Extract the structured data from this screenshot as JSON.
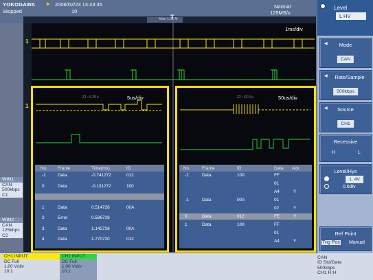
{
  "header": {
    "brand": "YOKOGAWA",
    "datetime": "2006/02/23 13:43:45",
    "run_state": "Stopped",
    "acq_count": "10",
    "acq_mode": "Normal",
    "sample_rate": "125MS/s",
    "trigger_marker": "T"
  },
  "display": {
    "main_time_div": "1ms/div",
    "zoom1_time_div": "5us/div",
    "zoom2_time_div": "50us/div",
    "channel_marker": "1",
    "scroll_label": "Main 1.25 M",
    "zoom1_label": "Z1 : 6.25 k",
    "zoom2_label": "Z2 : 62.5 k"
  },
  "softkeys": {
    "level_title": "Level",
    "level_value": "L  HV",
    "mode_title": "Mode",
    "mode_value": "CAN",
    "rate_title": "Rate/Sample",
    "rate_value": "500kbps",
    "source_title": "Source",
    "source_value": "CH1",
    "recessive_title": "Recessive",
    "recessive_h": "H",
    "recessive_l": "L",
    "level_hys_title": "Level/Hys",
    "level_hys_value": "1.  4V",
    "hys_value": "0.6div",
    "refpoint_title": "Ref Point",
    "refpoint_opt1": "Trig Pos",
    "refpoint_opt2": "Manual"
  },
  "table1": {
    "headers": [
      "No.",
      "Frame",
      "Time(ms)",
      "ID"
    ],
    "rows": [
      {
        "no": "-1",
        "frame": "Data",
        "time": "-0.741272",
        "id": "012",
        "hl": false
      },
      {
        "no": "0",
        "frame": "Data",
        "time": "-0.131272",
        "id": "100",
        "hl": false
      },
      {
        "no": "",
        "frame": "",
        "time": "",
        "id": "",
        "hl": true
      },
      {
        "no": "1",
        "frame": "Data",
        "time": "0.514728",
        "id": "00A",
        "hl": false
      },
      {
        "no": "2",
        "frame": "Error",
        "time": "0.586728",
        "id": "",
        "hl": false
      },
      {
        "no": "3",
        "frame": "Data",
        "time": "1.142728",
        "id": "00A",
        "hl": false
      },
      {
        "no": "4",
        "frame": "Data",
        "time": "1.770720",
        "id": "012",
        "hl": false
      }
    ]
  },
  "table2": {
    "headers": [
      "No.",
      "Frame",
      "ID",
      "Data",
      "Ack"
    ],
    "rows": [
      {
        "no": "-2",
        "frame": "Data",
        "id": "100",
        "data": "FF",
        "ack": ""
      },
      {
        "no": "",
        "frame": "",
        "id": "",
        "data": "01",
        "ack": ""
      },
      {
        "no": "",
        "frame": "",
        "id": "",
        "data": "A4",
        "ack": "Y"
      },
      {
        "no": "-1",
        "frame": "Data",
        "id": "00A",
        "data": "01",
        "ack": ""
      },
      {
        "no": "",
        "frame": "",
        "id": "",
        "data": "02",
        "ack": "Y"
      },
      {
        "no": "0",
        "frame": "Data",
        "id": "012",
        "data": "FE",
        "ack": "Y"
      },
      {
        "no": "1",
        "frame": "Data",
        "id": "100",
        "data": "FF",
        "ack": ""
      },
      {
        "no": "",
        "frame": "",
        "id": "",
        "data": "01",
        "ack": ""
      },
      {
        "no": "",
        "frame": "",
        "id": "",
        "data": "A4",
        "ack": "Y"
      }
    ]
  },
  "side_labels": {
    "win1_hdr": "WIN1",
    "win1_lines": [
      "CAN",
      "500kbps",
      "C1"
    ],
    "win2_hdr": "WIN2",
    "win2_lines": [
      "CAN",
      "125kbps",
      "C2"
    ]
  },
  "footer": {
    "ch1_hdr": "CH1  INPUT",
    "ch1_lines": [
      "DC Full",
      "1.00 V/div",
      "10:1"
    ],
    "ch2_hdr": "CH2  INPUT",
    "ch2_lines": [
      "DC Full",
      "1.00 V/div",
      "10:1"
    ],
    "trig_lines": [
      "CAN",
      "ID Std/Data",
      "500kbps",
      "CH1  R:H"
    ]
  },
  "colors": {
    "trace": "#ffe900",
    "trace_green": "#2fd83a",
    "zoom_frame": "#ffe100",
    "arrow": "#e0201c"
  }
}
